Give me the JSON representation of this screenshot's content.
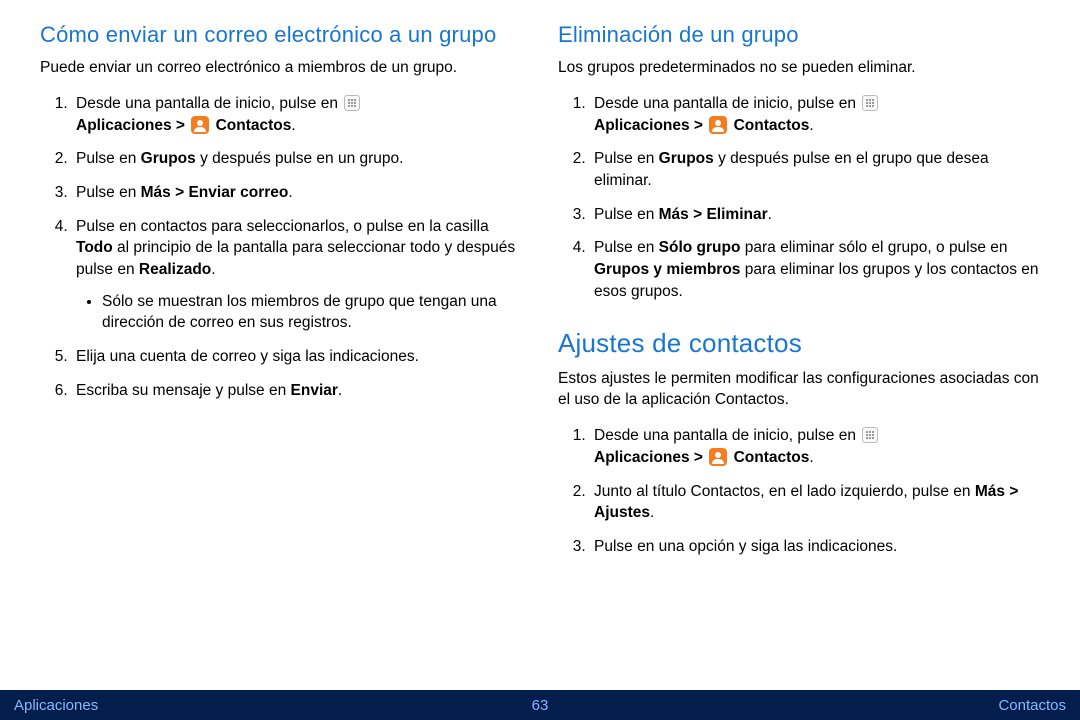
{
  "left": {
    "heading": "Cómo enviar un correo electrónico a un grupo",
    "intro": "Puede enviar un correo electrónico a miembros de un grupo.",
    "steps": {
      "s1_a": "Desde una pantalla de inicio, pulse en ",
      "s1_b": "Aplicaciones > ",
      "s1_c": " Contactos",
      "s2_a": "Pulse en ",
      "s2_b": "Grupos",
      "s2_c": " y después pulse en un grupo.",
      "s3_a": "Pulse en ",
      "s3_b": "Más > Enviar correo",
      "s4_a": "Pulse en contactos para seleccionarlos, o pulse en la casilla ",
      "s4_b": "Todo",
      "s4_c": " al principio de la pantalla para seleccionar todo y después pulse en ",
      "s4_d": "Realizado",
      "s4_bullet": "Sólo se muestran los miembros de grupo que tengan una dirección de correo en sus registros.",
      "s5": "Elija una cuenta de correo y siga las indicaciones.",
      "s6_a": "Escriba su mensaje y pulse en ",
      "s6_b": "Enviar"
    }
  },
  "rightA": {
    "heading": "Eliminación de un grupo",
    "intro": "Los grupos predeterminados no se pueden eliminar.",
    "steps": {
      "s1_a": "Desde una pantalla de inicio, pulse en ",
      "s1_b": "Aplicaciones > ",
      "s1_c": " Contactos",
      "s2_a": "Pulse en ",
      "s2_b": "Grupos",
      "s2_c": " y después pulse en el grupo que desea eliminar.",
      "s3_a": "Pulse en ",
      "s3_b": "Más > Eliminar",
      "s4_a": "Pulse en ",
      "s4_b": "Sólo grupo",
      "s4_c": " para eliminar sólo el grupo, o pulse en ",
      "s4_d": "Grupos y miembros",
      "s4_e": " para eliminar los grupos y los contactos en esos grupos."
    }
  },
  "rightB": {
    "heading": "Ajustes de contactos",
    "intro": "Estos ajustes le permiten modificar las configuraciones asociadas con el uso de la aplicación Contactos.",
    "steps": {
      "s1_a": "Desde una pantalla de inicio, pulse en ",
      "s1_b": "Aplicaciones > ",
      "s1_c": " Contactos",
      "s2_a": "Junto al título Contactos, en el lado izquierdo, pulse en ",
      "s2_b": "Más > Ajustes",
      "s3": "Pulse en una opción y siga las indicaciones."
    }
  },
  "footer": {
    "left": "Aplicaciones",
    "page": "63",
    "right": "Contactos"
  },
  "period": "."
}
